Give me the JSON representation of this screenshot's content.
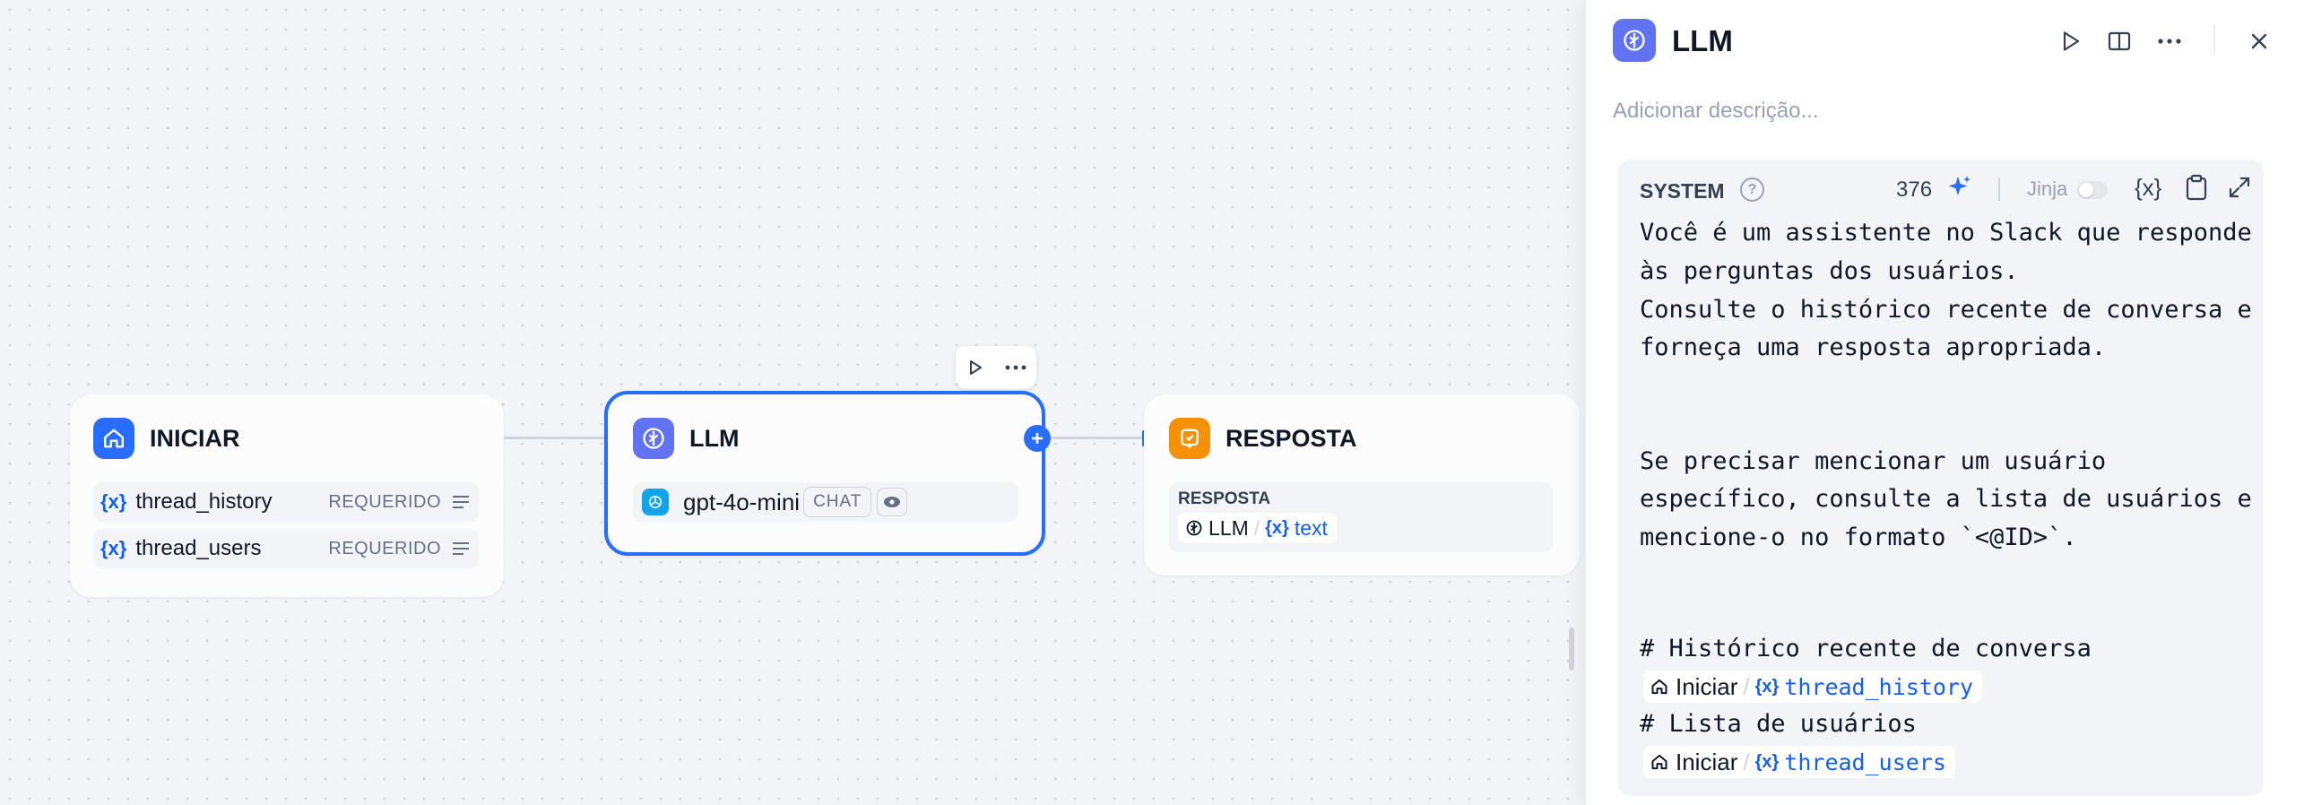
{
  "canvas": {
    "start_node": {
      "title": "INICIAR",
      "variables": [
        {
          "name": "thread_history",
          "badge": "REQUERIDO"
        },
        {
          "name": "thread_users",
          "badge": "REQUERIDO"
        }
      ]
    },
    "llm_node": {
      "title": "LLM",
      "model": "gpt-4o-mini",
      "mode_badge": "CHAT"
    },
    "answer_node": {
      "title": "RESPOSTA",
      "field_label": "RESPOSTA",
      "ref_node": "LLM",
      "ref_var": "text"
    },
    "var_symbol": "{x}"
  },
  "panel": {
    "title": "LLM",
    "description_placeholder": "Adicionar descrição...",
    "system": {
      "label": "SYSTEM",
      "char_count": "376",
      "jinja_label": "Jinja",
      "jinja_enabled": false,
      "prompt_lines": [
        "Você é um assistente no Slack que responde",
        "às perguntas dos usuários.",
        "Consulte o histórico recente de conversa e",
        "forneça uma resposta apropriada.",
        "Se precisar mencionar um usuário",
        "específico, consulte a lista de usuários e",
        "mencione-o no formato `<@ID>`.",
        "# Histórico recente de conversa",
        "# Lista de usuários"
      ],
      "refs": [
        {
          "node": "Iniciar",
          "var": "thread_history"
        },
        {
          "node": "Iniciar",
          "var": "thread_users"
        }
      ]
    }
  },
  "colors": {
    "accent": "#155eef",
    "start_icon_bg": "#296dff",
    "llm_icon_bg": "#6172f3",
    "answer_icon_bg": "#f79009",
    "selected_border": "#296dff"
  }
}
